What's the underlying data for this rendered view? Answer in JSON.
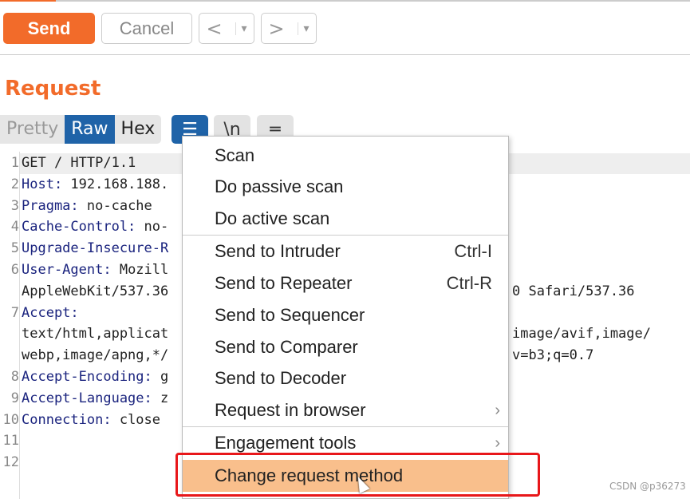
{
  "toolbar": {
    "send": "Send",
    "cancel": "Cancel",
    "back": "<",
    "forward": ">",
    "dropdown": "▾"
  },
  "request": {
    "title": "Request",
    "tabs": [
      "Pretty",
      "Raw",
      "Hex"
    ],
    "active_tab": "Raw",
    "newline_btn": "\\n"
  },
  "editor": {
    "lines": [
      {
        "n": "1",
        "key": "GET / HTTP/1.1",
        "val": "",
        "right": ""
      },
      {
        "n": "2",
        "key": "Host:",
        "val": " 192.168.188.",
        "right": ""
      },
      {
        "n": "3",
        "key": "Pragma:",
        "val": " no-cache",
        "right": ""
      },
      {
        "n": "4",
        "key": "Cache-Control:",
        "val": " no-",
        "right": ""
      },
      {
        "n": "5",
        "key": "Upgrade-Insecure-R",
        "val": "",
        "right": ""
      },
      {
        "n": "6",
        "key": "User-Agent:",
        "val": " Mozill",
        "right": ""
      },
      {
        "n": "",
        "key": "",
        "val": "AppleWebKit/537.36",
        "right": "0 Safari/537.36"
      },
      {
        "n": "7",
        "key": "Accept:",
        "val": "",
        "right": ""
      },
      {
        "n": "",
        "key": "",
        "val": "text/html,applicat",
        "right": "image/avif,image/"
      },
      {
        "n": "",
        "key": "",
        "val": "webp,image/apng,*/",
        "right": "v=b3;q=0.7"
      },
      {
        "n": "8",
        "key": "Accept-Encoding:",
        "val": " g",
        "right": ""
      },
      {
        "n": "9",
        "key": "Accept-Language:",
        "val": " z",
        "right": ""
      },
      {
        "n": "10",
        "key": "Connection:",
        "val": " close",
        "right": ""
      },
      {
        "n": "11",
        "key": "",
        "val": "",
        "right": ""
      },
      {
        "n": "12",
        "key": "",
        "val": "",
        "right": ""
      }
    ]
  },
  "context_menu": {
    "items": [
      {
        "label": "Scan"
      },
      {
        "label": "Do passive scan"
      },
      {
        "label": "Do active scan"
      },
      {
        "label": "Send to Intruder",
        "shortcut": "Ctrl-I"
      },
      {
        "label": "Send to Repeater",
        "shortcut": "Ctrl-R"
      },
      {
        "label": "Send to Sequencer"
      },
      {
        "label": "Send to Comparer"
      },
      {
        "label": "Send to Decoder"
      },
      {
        "label": "Request in browser",
        "submenu": "›"
      },
      {
        "label": "Engagement tools",
        "submenu": "›"
      },
      {
        "label": "Change request method",
        "selected": true
      }
    ]
  },
  "watermark": "CSDN @p36273",
  "colors": {
    "accent": "#f26b2a",
    "active_tab": "#1f63a8",
    "menu_highlight": "#f9bf8c",
    "annotation": "#e8171a"
  }
}
